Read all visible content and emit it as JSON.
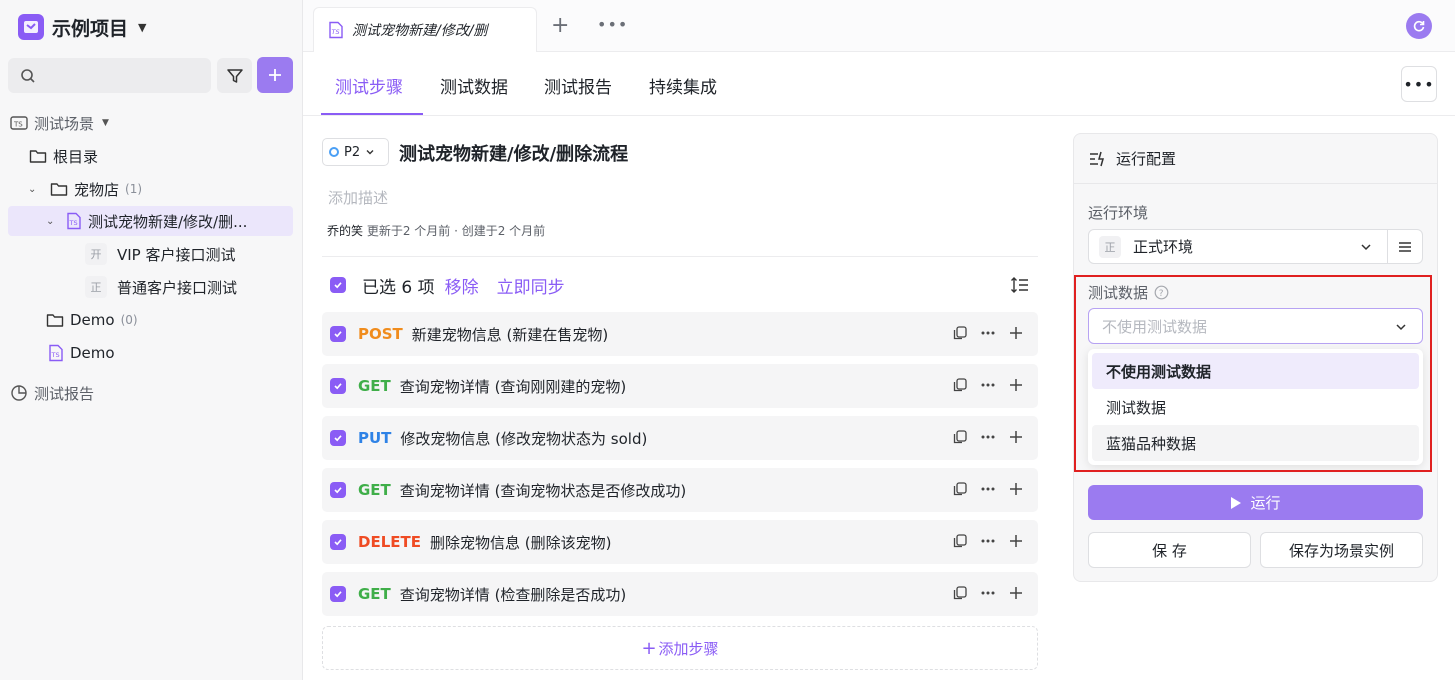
{
  "sidebar": {
    "project_name": "示例项目",
    "search_placeholder": "",
    "tree": {
      "scenarios_label": "测试场景",
      "root": "根目录",
      "petstore": "宠物店",
      "petstore_count": "(1)",
      "current_scenario": "测试宠物新建/修改/删...",
      "envs": [
        {
          "chip": "开",
          "name": "VIP 客户接口测试"
        },
        {
          "chip": "正",
          "name": "普通客户接口测试"
        }
      ],
      "demo_folder": "Demo",
      "demo_count": "(0)",
      "demo_scenario": "Demo",
      "reports_label": "测试报告"
    }
  },
  "tabbar": {
    "doc_tab": "测试宠物新建/修改/删"
  },
  "subtabs": [
    "测试步骤",
    "测试数据",
    "测试报告",
    "持续集成"
  ],
  "scenario": {
    "priority": "P2",
    "title": "测试宠物新建/修改/删除流程",
    "description_placeholder": "添加描述",
    "author": "乔的笑",
    "updated": "更新于2 个月前 · 创建于2 个月前"
  },
  "selection": {
    "count_text": "已选 6 项",
    "remove": "移除",
    "sync": "立即同步"
  },
  "steps": [
    {
      "method": "POST",
      "name": "新建宠物信息 (新建在售宠物)"
    },
    {
      "method": "GET",
      "name": "查询宠物详情 (查询刚刚建的宠物)"
    },
    {
      "method": "PUT",
      "name": "修改宠物信息 (修改宠物状态为 sold)"
    },
    {
      "method": "GET",
      "name": "查询宠物详情 (查询宠物状态是否修改成功)"
    },
    {
      "method": "DELETE",
      "name": "删除宠物信息 (删除该宠物)"
    },
    {
      "method": "GET",
      "name": "查询宠物详情 (检查删除是否成功)"
    }
  ],
  "add_step": "添加步骤",
  "run_config": {
    "title": "运行配置",
    "env_label": "运行环境",
    "env_chip": "正",
    "env_value": "正式环境",
    "data_label": "测试数据",
    "data_placeholder": "不使用测试数据",
    "options": [
      "不使用测试数据",
      "测试数据",
      "蓝猫品种数据"
    ],
    "run": "运行",
    "save": "保 存",
    "save_as": "保存为场景实例"
  },
  "colors": {
    "accent": "#8a5cf5",
    "post": "#f08c1d",
    "get": "#3fae49",
    "put": "#2e82e6",
    "delete": "#ef4b23",
    "highlight": "#e02020"
  }
}
